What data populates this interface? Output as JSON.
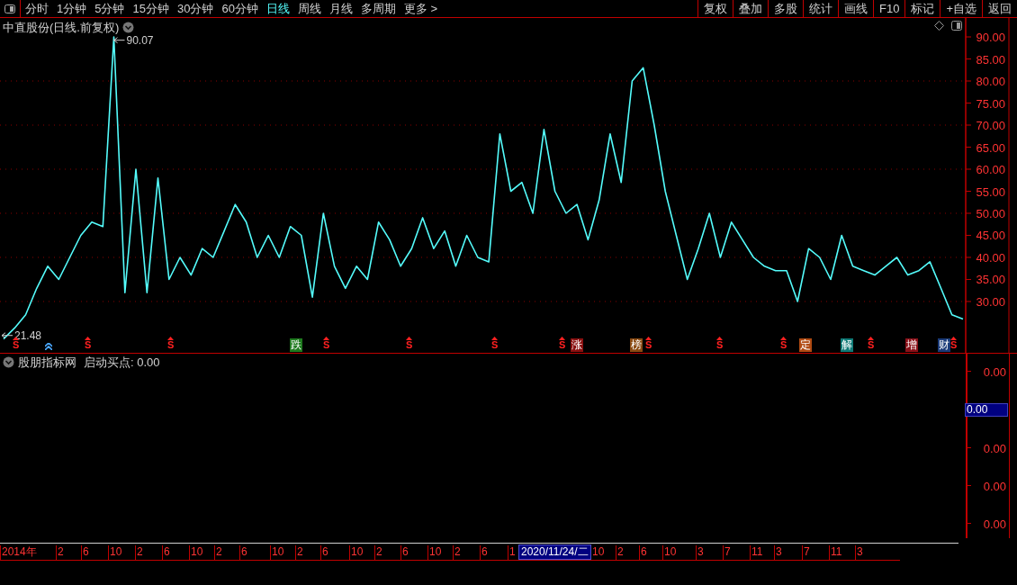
{
  "toolbar": {
    "tabs": [
      {
        "label": "分时",
        "selected": false
      },
      {
        "label": "1分钟",
        "selected": false
      },
      {
        "label": "5分钟",
        "selected": false
      },
      {
        "label": "15分钟",
        "selected": false
      },
      {
        "label": "30分钟",
        "selected": false
      },
      {
        "label": "60分钟",
        "selected": false
      },
      {
        "label": "日线",
        "selected": true
      },
      {
        "label": "周线",
        "selected": false
      },
      {
        "label": "月线",
        "selected": false
      },
      {
        "label": "多周期",
        "selected": false
      },
      {
        "label": "更多 >",
        "selected": false
      }
    ],
    "buttons": [
      "复权",
      "叠加",
      "多股",
      "统计",
      "画线",
      "F10",
      "标记",
      "+自选",
      "返回"
    ]
  },
  "price_pane": {
    "title": "中直股份(日线.前复权)",
    "chart_data": {
      "type": "line",
      "grid": true,
      "ylim": [
        18.16,
        94.29
      ],
      "yticks": [
        {
          "value": 30,
          "label": "30.00"
        },
        {
          "value": 35,
          "label": "35.00"
        },
        {
          "value": 40,
          "label": "40.00"
        },
        {
          "value": 45,
          "label": "45.00"
        },
        {
          "value": 50,
          "label": "50.00"
        },
        {
          "value": 55,
          "label": "55.00"
        },
        {
          "value": 60,
          "label": "60.00"
        },
        {
          "value": 65,
          "label": "65.00"
        },
        {
          "value": 70,
          "label": "70.00"
        },
        {
          "value": 75,
          "label": "75.00"
        },
        {
          "value": 80,
          "label": "80.00"
        },
        {
          "value": 85,
          "label": "85.00"
        },
        {
          "value": 90,
          "label": "90.00"
        }
      ],
      "series": [
        {
          "color": "#54fcfc",
          "values": [
            21.5,
            24,
            27,
            33,
            38,
            35,
            40,
            45,
            48,
            47,
            90,
            32,
            60,
            32,
            58,
            35,
            40,
            36,
            42,
            40,
            46,
            52,
            48,
            40,
            45,
            40,
            47,
            45,
            31,
            50,
            38,
            33,
            38,
            35,
            48,
            44,
            38,
            42,
            49,
            42,
            46,
            38,
            45,
            40,
            39,
            68,
            55,
            57,
            50,
            69,
            55,
            50,
            52,
            44,
            53,
            68,
            57,
            80,
            83,
            70,
            55,
            45,
            35,
            42,
            50,
            40,
            48,
            44,
            40,
            38,
            37,
            37,
            30,
            42,
            40,
            35,
            45,
            38,
            37,
            36,
            38,
            40,
            36,
            37,
            39,
            33,
            27,
            26
          ]
        }
      ],
      "annotations": [
        "90.07",
        "21.48"
      ]
    },
    "markers": [
      {
        "kind": "signal",
        "text": "S"
      },
      {
        "kind": "arrow"
      },
      {
        "kind": "signal",
        "text": "S"
      },
      {
        "kind": "signal",
        "text": "S"
      },
      {
        "kind": "badge",
        "text": "跌",
        "color": "#1e7a1e"
      },
      {
        "kind": "signal",
        "text": "S"
      },
      {
        "kind": "signal",
        "text": "S"
      },
      {
        "kind": "signal",
        "text": "S"
      },
      {
        "kind": "signal",
        "text": "S"
      },
      {
        "kind": "badge",
        "text": "涨",
        "color": "#8a1010"
      },
      {
        "kind": "badge",
        "text": "榜",
        "color": "#8a4a12"
      },
      {
        "kind": "signal",
        "text": "S"
      },
      {
        "kind": "signal",
        "text": "S"
      },
      {
        "kind": "signal",
        "text": "S"
      },
      {
        "kind": "badge",
        "text": "定",
        "color": "#b04a12"
      },
      {
        "kind": "badge",
        "text": "解",
        "color": "#0f7a76"
      },
      {
        "kind": "signal",
        "text": "S"
      },
      {
        "kind": "badge",
        "text": "增",
        "color": "#8a1018"
      },
      {
        "kind": "badge",
        "text": "财",
        "color": "#1a3a78"
      },
      {
        "kind": "signal",
        "text": "S"
      }
    ]
  },
  "indicator_pane": {
    "name": "股朋指标网",
    "reading": "启动买点: 0.00",
    "axis_labels": [
      "0.00",
      "0.00",
      "0.00",
      "0.00"
    ],
    "cursor_value": "0.00"
  },
  "time_axis": {
    "labels": [
      "2014年",
      "2",
      "6",
      "10",
      "2",
      "6",
      "10",
      "2",
      "6",
      "10",
      "2",
      "6",
      "10",
      "2",
      "6",
      "10",
      "2",
      "6",
      "1",
      "10",
      "2",
      "6",
      "10",
      "3",
      "7",
      "11",
      "3",
      "7",
      "11",
      "3"
    ],
    "cursor_date": "2020/11/24/二"
  }
}
